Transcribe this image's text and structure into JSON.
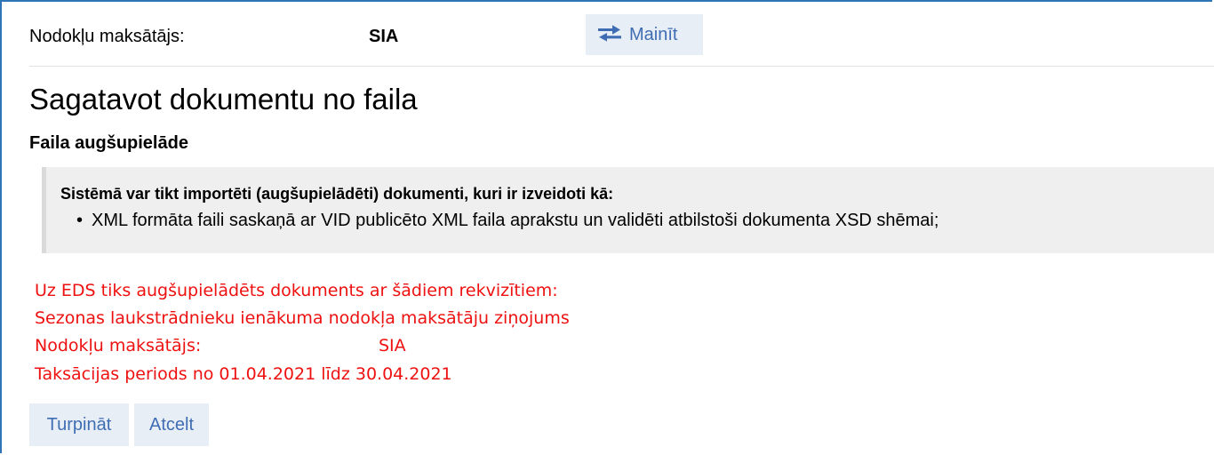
{
  "taxpayer": {
    "label": "Nodokļu maksātājs:",
    "value": "SIA",
    "change_button": "Mainīt",
    "change_icon": "swap-arrows-icon"
  },
  "page": {
    "title": "Sagatavot dokumentu no faila",
    "subtitle": "Faila augšupielāde"
  },
  "info": {
    "title": "Sistēmā var tikt importēti (augšupielādēti) dokumenti, kuri ir izveidoti kā:",
    "items": [
      "XML formāta faili saskaņā ar VID publicēto XML faila aprakstu un validēti atbilstoši dokumenta XSD shēmai;"
    ]
  },
  "notice": {
    "line1": "Uz EDS tiks augšupielādēts dokuments ar šādiem rekvizītiem:",
    "line2": "Sezonas laukstrādnieku ienākuma nodokļa maksātāju ziņojums",
    "taxpayer_label": "Nodokļu maksātājs:",
    "taxpayer_value": "SIA",
    "line4": "Taksācijas periods no 01.04.2021 līdz 30.04.2021",
    "color": "#ee1111"
  },
  "actions": {
    "continue": "Turpināt",
    "cancel": "Atcelt"
  },
  "colors": {
    "frame_border": "#2e75b6",
    "button_bg": "#e8eef5",
    "button_text": "#3f6db3"
  }
}
